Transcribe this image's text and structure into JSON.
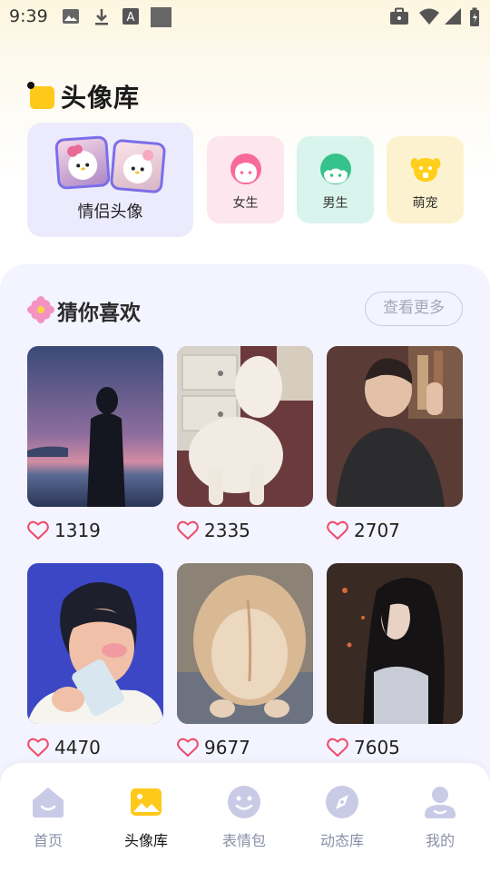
{
  "status_bar": {
    "time": "9:39"
  },
  "header": {
    "title": "头像库"
  },
  "categories": {
    "couple": {
      "label": "情侣头像"
    },
    "items": [
      {
        "label": "女生",
        "bg": "#fde6ee",
        "accent": "#f86b98",
        "icon": "girl-face-icon"
      },
      {
        "label": "男生",
        "bg": "#d9f4ec",
        "accent": "#35c28c",
        "icon": "boy-face-icon"
      },
      {
        "label": "萌宠",
        "bg": "#fdf2cf",
        "accent": "#ffcf1d",
        "icon": "pet-icon"
      }
    ]
  },
  "recommend": {
    "title": "猜你喜欢",
    "more_label": "查看更多",
    "items": [
      {
        "likes": "1319",
        "image": "silhouette-sunset"
      },
      {
        "likes": "2335",
        "image": "white-dog"
      },
      {
        "likes": "2707",
        "image": "boy-selfie"
      },
      {
        "likes": "4470",
        "image": "illustrated-boy-drinking"
      },
      {
        "likes": "9677",
        "image": "corgi-butt"
      },
      {
        "likes": "7605",
        "image": "long-hair-girl"
      }
    ]
  },
  "bottom_nav": {
    "items": [
      {
        "label": "首页",
        "icon": "home-icon",
        "active": false
      },
      {
        "label": "头像库",
        "icon": "image-icon",
        "active": true
      },
      {
        "label": "表情包",
        "icon": "smile-icon",
        "active": false
      },
      {
        "label": "动态库",
        "icon": "compass-icon",
        "active": false
      },
      {
        "label": "我的",
        "icon": "profile-icon",
        "active": false
      }
    ]
  },
  "colors": {
    "brand": "#ffc91a",
    "heart": "#ef4b6a",
    "nav_inactive": "#c9cbe6"
  }
}
